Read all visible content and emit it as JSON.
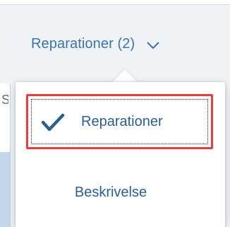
{
  "header": {
    "label": "Reparationer (2)",
    "dropdown_icon": "chevron-down-icon"
  },
  "menu": {
    "items": [
      {
        "label": "Reparationer",
        "selected": true,
        "icon": "check-icon"
      },
      {
        "label": "Beskrivelse",
        "selected": false
      }
    ]
  },
  "colors": {
    "accent": "#3a74a8",
    "item_text": "#2c5f8e",
    "selection_outline": "#e24040",
    "background": "#eff3f6"
  }
}
